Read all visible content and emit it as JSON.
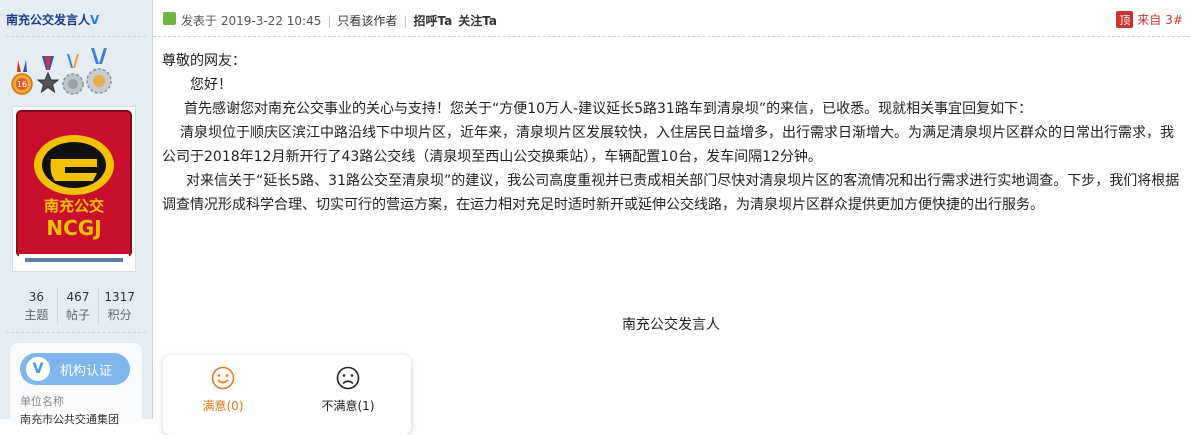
{
  "author": {
    "name": "南充公交发言人",
    "verified_badge": "V"
  },
  "medals": [
    "medal-16-icon",
    "medal-star-icon",
    "medal-gear-icon",
    "medal-gear-gold-icon"
  ],
  "avatar": {
    "logo_text": "南充公交",
    "logo_letters": "NCGJ",
    "colors": {
      "red": "#c8102e",
      "yellow": "#f2c200"
    }
  },
  "stats": [
    {
      "value": "36",
      "label": "主题"
    },
    {
      "value": "467",
      "label": "帖子"
    },
    {
      "value": "1317",
      "label": "积分"
    }
  ],
  "org": {
    "button_label": "机构认证",
    "field_label": "单位名称",
    "field_value": "南充市公共交通集团"
  },
  "post": {
    "posted_prefix": "发表于",
    "posted_time": "2019-3-22 10:45",
    "only_author": "只看该作者",
    "greet": "招呼Ta",
    "follow": "关注Ta",
    "floor_icon": "顶",
    "floor_from": "来自",
    "floor_number": "3#"
  },
  "content": {
    "salutation": "尊敬的网友：",
    "greeting": "您好！",
    "paragraphs": [
      "首先感谢您对南充公交事业的关心与支持！您关于“方便10万人-建议延长5路31路车到清泉坝”的来信，已收悉。现就相关事宜回复如下：",
      "清泉坝位于顺庆区滨江中路沿线下中坝片区，近年来，清泉坝片区发展较快，入住居民日益增多，出行需求日渐增大。为满足清泉坝片区群众的日常出行需求，我公司于2018年12月新开行了43路公交线（清泉坝至西山公交换乘站），车辆配置10台，发车间隔12分钟。",
      "对来信关于“延长5路、31路公交至清泉坝”的建议，我公司高度重视并已责成相关部门尽快对清泉坝片区的客流情况和出行需求进行实地调查。下步，我们将根据调查情况形成科学合理、切实可行的营运方案，在运力相对充足时适时新开或延伸公交线路，为清泉坝片区群众提供更加方便快捷的出行服务。"
    ],
    "signature": "南充公交发言人"
  },
  "votes": {
    "satisfied": {
      "label": "满意(0)",
      "icon": "smile-icon",
      "color": "#e8761c"
    },
    "unsatisfied": {
      "label": "不满意(1)",
      "icon": "frown-icon",
      "color": "#222222"
    }
  }
}
